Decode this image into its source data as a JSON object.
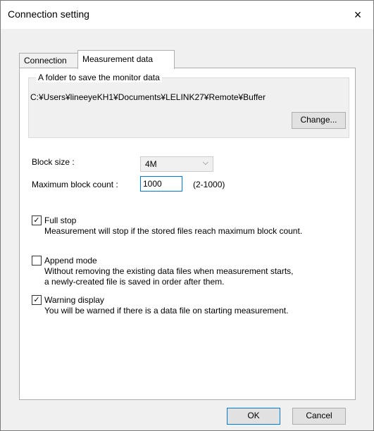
{
  "window": {
    "title": "Connection setting",
    "close_icon": "×"
  },
  "tabs": [
    {
      "label": "Connection"
    },
    {
      "label": "Measurement data"
    }
  ],
  "folder_group": {
    "title": "A folder to save the monitor data",
    "path": "C:¥Users¥lineeyeKH1¥Documents¥LELINK27¥Remote¥Buffer",
    "change_label": "Change..."
  },
  "block_size": {
    "label": "Block size :",
    "value": "4M"
  },
  "max_block": {
    "label": "Maximum block count :",
    "value": "1000",
    "range": "(2-1000)"
  },
  "options": [
    {
      "label": "Full stop",
      "checked": true,
      "desc1": "Measurement will stop if the stored files reach maximum block count."
    },
    {
      "label": "Append mode",
      "checked": false,
      "desc1": "Without removing the existing data files when measurement starts,",
      "desc2": "a newly-created file is saved in order after them."
    },
    {
      "label": "Warning display",
      "checked": true,
      "desc1": "You will be warned if there is a data file on starting measurement."
    }
  ],
  "buttons": {
    "ok": "OK",
    "cancel": "Cancel"
  }
}
